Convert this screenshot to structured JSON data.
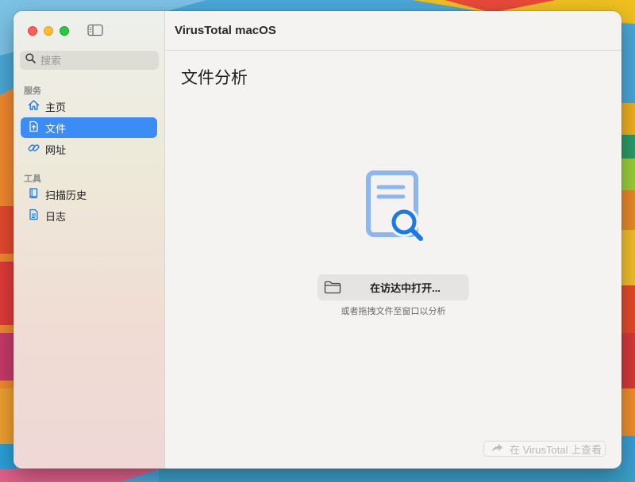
{
  "window": {
    "title": "VirusTotal macOS"
  },
  "sidebar": {
    "search_placeholder": "搜索",
    "sections": [
      {
        "title": "服务",
        "items": [
          {
            "label": "主页",
            "icon": "house-icon",
            "active": false
          },
          {
            "label": "文件",
            "icon": "document-icon",
            "active": true
          },
          {
            "label": "网址",
            "icon": "link-icon",
            "active": false
          }
        ]
      },
      {
        "title": "工具",
        "items": [
          {
            "label": "扫描历史",
            "icon": "book-icon",
            "active": false
          },
          {
            "label": "日志",
            "icon": "log-document-icon",
            "active": false
          }
        ]
      }
    ]
  },
  "main": {
    "page_title": "文件分析",
    "open_button_label": "在访达中打开...",
    "hint": "或者拖拽文件至窗口以分析",
    "view_on_vt_label": "在 VirusTotal 上查看"
  },
  "colors": {
    "accent": "#3c8cf5",
    "illustration_light": "#8ab6f2",
    "illustration_dark": "#1a7ae8"
  }
}
